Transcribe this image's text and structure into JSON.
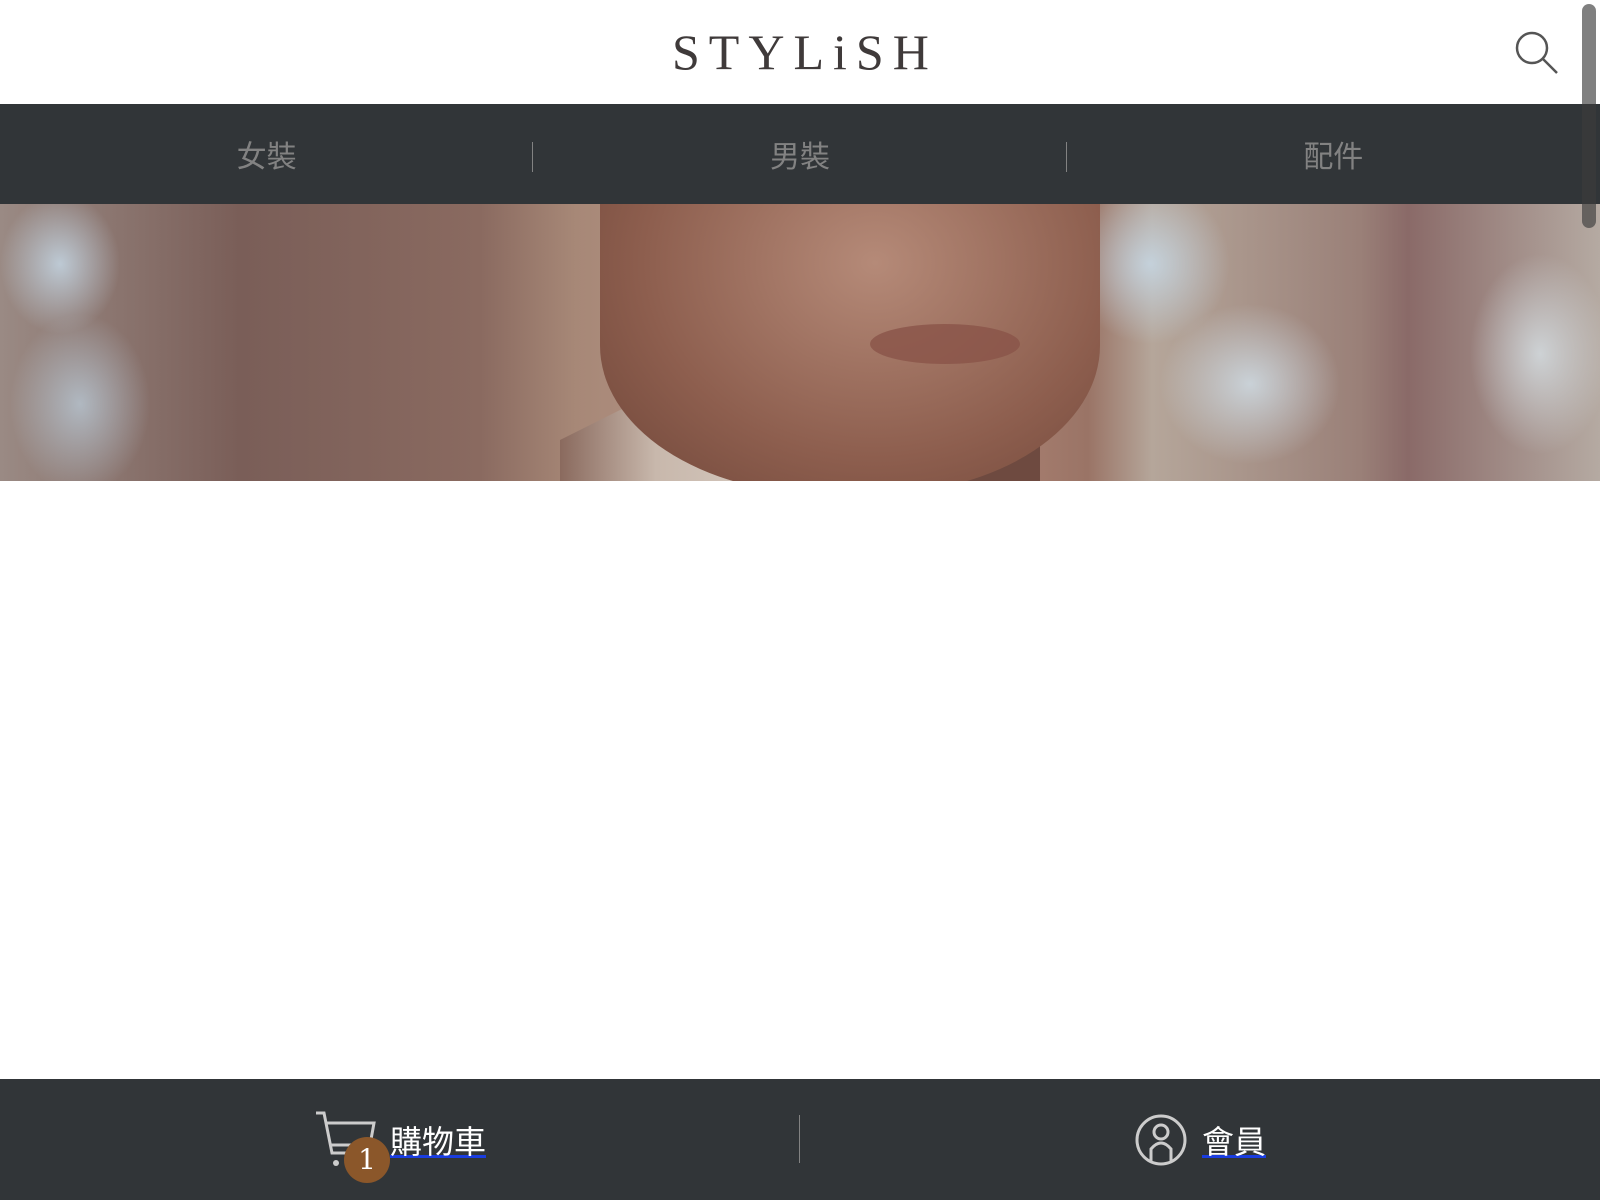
{
  "header": {
    "logo": "STYLiSH",
    "search_icon": "search-icon"
  },
  "nav": {
    "items": [
      {
        "label": "女裝"
      },
      {
        "label": "男裝"
      },
      {
        "label": "配件"
      }
    ]
  },
  "banner": {
    "alt": "man portrait"
  },
  "footer": {
    "cart_label": "購物車",
    "cart_count": "1",
    "member_label": "會員"
  },
  "colors": {
    "nav_bg": "#313538",
    "nav_text": "#828282",
    "badge": "#8b572a",
    "logo": "#3f3a3a"
  }
}
